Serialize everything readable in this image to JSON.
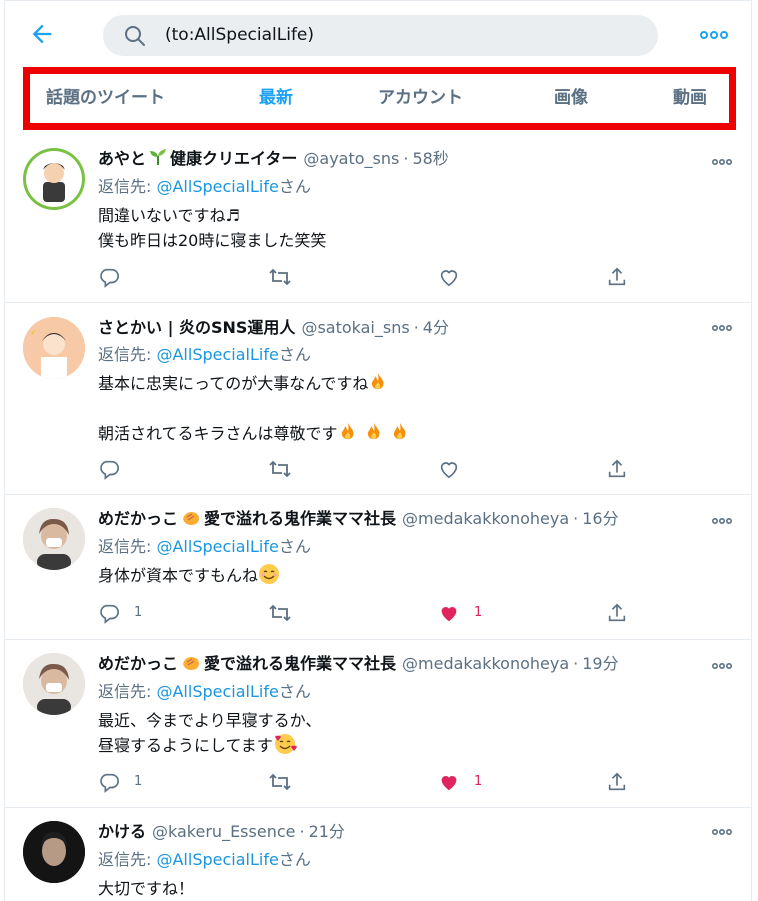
{
  "header": {
    "search_query": "(to:AllSpecialLife)"
  },
  "tabs": [
    {
      "label": "話題のツイート",
      "active": false
    },
    {
      "label": "最新",
      "active": true
    },
    {
      "label": "アカウント",
      "active": false
    },
    {
      "label": "画像",
      "active": false
    },
    {
      "label": "動画",
      "active": false
    }
  ],
  "colors": {
    "accent": "#1da1f2",
    "highlight_box": "#ee0000",
    "like": "#e0245e"
  },
  "tweets": [
    {
      "name_prefix": "あやと",
      "name_suffix": "健康クリエイター",
      "handle": "@ayato_sns",
      "time": "58秒",
      "reply_label": "返信先: ",
      "reply_to": "@AllSpecialLife",
      "reply_suffix": "さん",
      "line1": "間違いないですね♬",
      "line2": "僕も昨日は20時に寝ました笑笑",
      "reply_count": "",
      "like_count": "",
      "liked": false
    },
    {
      "name": "さとかい | 炎のSNS運用人",
      "handle": "@satokai_sns",
      "time": "4分",
      "reply_label": "返信先: ",
      "reply_to": "@AllSpecialLife",
      "reply_suffix": "さん",
      "line1": "基本に忠実にってのが大事なんですね",
      "line2": "",
      "line3": "朝活されてるキラさんは尊敬です",
      "reply_count": "",
      "like_count": "",
      "liked": false
    },
    {
      "name_prefix": "めだかっこ",
      "name_suffix": "愛で溢れる鬼作業ママ社長",
      "handle": "@medakakkonoheya",
      "time": "16分",
      "reply_label": "返信先: ",
      "reply_to": "@AllSpecialLife",
      "reply_suffix": "さん",
      "line1": "身体が資本ですもんね",
      "reply_count": "1",
      "like_count": "1",
      "liked": true
    },
    {
      "name_prefix": "めだかっこ",
      "name_suffix": "愛で溢れる鬼作業ママ社長",
      "handle": "@medakakkonoheya",
      "time": "19分",
      "reply_label": "返信先: ",
      "reply_to": "@AllSpecialLife",
      "reply_suffix": "さん",
      "line1": "最近、今までより早寝するか、",
      "line2": "昼寝するようにしてます",
      "reply_count": "1",
      "like_count": "1",
      "liked": true
    },
    {
      "name": "かける",
      "handle": "@kakeru_Essence",
      "time": "21分",
      "reply_label": "返信先: ",
      "reply_to": "@AllSpecialLife",
      "reply_suffix": "さん",
      "line1": "大切ですね！"
    }
  ]
}
